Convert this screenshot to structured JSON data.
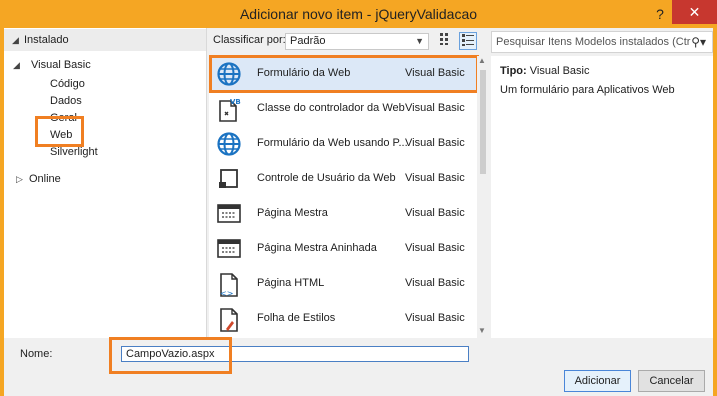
{
  "window": {
    "title": "Adicionar novo item - jQueryValidacao",
    "help_label": "?",
    "close_label": "✕"
  },
  "tree": {
    "installed_label": "Instalado",
    "visual_basic_label": "Visual Basic",
    "children": [
      "Código",
      "Dados",
      "Geral",
      "Web",
      "Silverlight"
    ],
    "online_label": "Online"
  },
  "toolbar": {
    "sort_label": "Classificar por:",
    "sort_value": "Padrão",
    "view_icons": [
      "grid-view-icon",
      "list-view-icon"
    ]
  },
  "search": {
    "placeholder": "Pesquisar Itens Modelos instalados (Ctr"
  },
  "templates": [
    {
      "name": "Formulário da Web",
      "type": "Visual Basic",
      "icon": "globe-icon",
      "selected": true
    },
    {
      "name": "Classe do controlador da Web",
      "type": "Visual Basic",
      "icon": "vb-class-icon",
      "selected": false
    },
    {
      "name": "Formulário da Web usando P...",
      "type": "Visual Basic",
      "icon": "globe-icon",
      "selected": false
    },
    {
      "name": "Controle de Usuário da Web",
      "type": "Visual Basic",
      "icon": "user-control-icon",
      "selected": false
    },
    {
      "name": "Página Mestra",
      "type": "Visual Basic",
      "icon": "master-page-icon",
      "selected": false
    },
    {
      "name": "Página Mestra Aninhada",
      "type": "Visual Basic",
      "icon": "master-page-icon",
      "selected": false
    },
    {
      "name": "Página HTML",
      "type": "Visual Basic",
      "icon": "html-page-icon",
      "selected": false
    },
    {
      "name": "Folha de Estilos",
      "type": "Visual Basic",
      "icon": "stylesheet-icon",
      "selected": false
    }
  ],
  "details": {
    "type_label": "Tipo:",
    "type_value": "Visual Basic",
    "description": "Um formulário para Aplicativos Web"
  },
  "footer": {
    "name_label": "Nome:",
    "name_value": "CampoVazio.aspx",
    "add_button": "Adicionar",
    "cancel_button": "Cancelar"
  },
  "colors": {
    "title_bar": "#f5a623",
    "highlight": "#f07f22",
    "selection": "#dce8f7",
    "globe": "#1b73c2"
  }
}
